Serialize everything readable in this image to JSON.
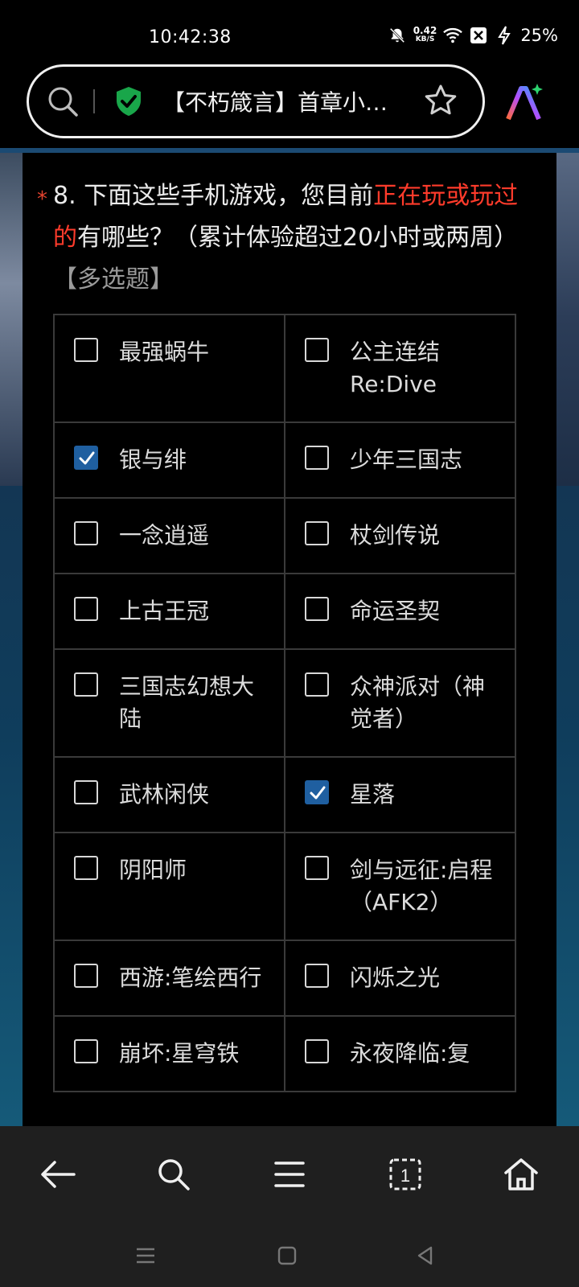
{
  "status_bar": {
    "time": "10:42:38",
    "net_speed_value": "0.42",
    "net_speed_unit": "KB/S",
    "battery": "25%",
    "icons": [
      "bell-off-icon",
      "wifi-icon",
      "sim-x-icon",
      "charging-icon"
    ]
  },
  "browser": {
    "tab_title": "【不朽箴言】首章小…",
    "security_icon": "shield-check-icon",
    "accent_green": "#19a64a"
  },
  "question": {
    "number": "8.",
    "text_before": "下面这些手机游戏，您目前",
    "highlight": "正在玩或玩过的",
    "text_after": "有哪些？（累计体验超过20小时或两周）",
    "tag": "【多选题】",
    "required_mark": "*",
    "highlight_color": "#ff3b2b"
  },
  "options": [
    {
      "label": "最强蜗牛",
      "checked": false
    },
    {
      "label": "公主连结Re:Dive",
      "checked": false
    },
    {
      "label": "银与绯",
      "checked": true
    },
    {
      "label": "少年三国志",
      "checked": false
    },
    {
      "label": "一念逍遥",
      "checked": false
    },
    {
      "label": "杖剑传说",
      "checked": false
    },
    {
      "label": "上古王冠",
      "checked": false
    },
    {
      "label": "命运圣契",
      "checked": false
    },
    {
      "label": "三国志幻想大陆",
      "checked": false
    },
    {
      "label": "众神派对（神觉者）",
      "checked": false
    },
    {
      "label": "武林闲侠",
      "checked": false
    },
    {
      "label": "星落",
      "checked": true
    },
    {
      "label": "阴阳师",
      "checked": false
    },
    {
      "label": "剑与远征:启程（AFK2）",
      "checked": false
    },
    {
      "label": "西游:笔绘西行",
      "checked": false
    },
    {
      "label": "闪烁之光",
      "checked": false
    },
    {
      "label": "崩坏:星穹铁",
      "checked": false
    },
    {
      "label": "永夜降临:复",
      "checked": false
    }
  ],
  "bottom_nav": [
    "back-arrow-icon",
    "search-icon",
    "menu-icon",
    "tabs-icon",
    "home-icon"
  ],
  "tabs_count": "1"
}
